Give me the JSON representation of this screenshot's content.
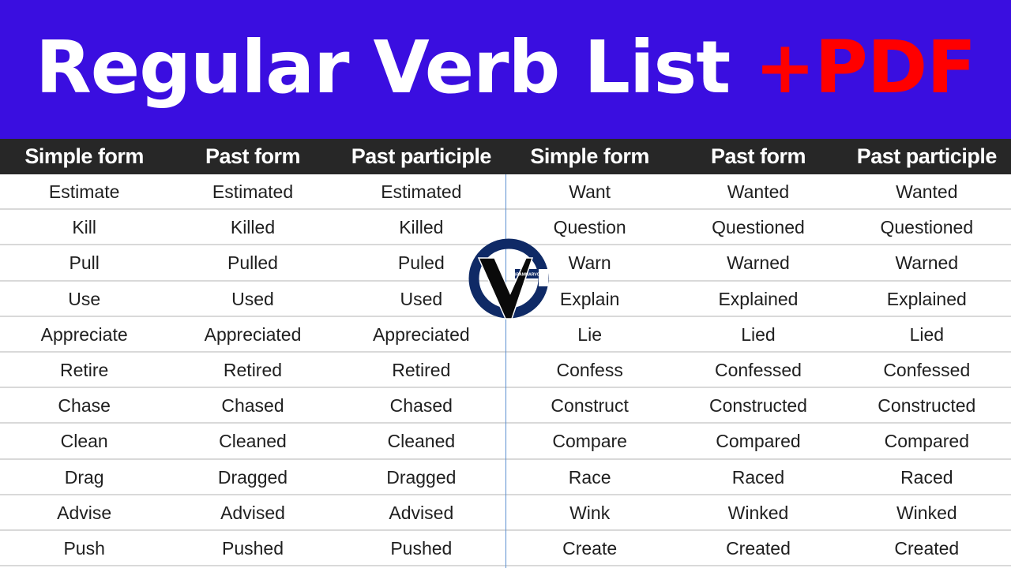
{
  "banner": {
    "title": "Regular Verb List ",
    "accent": "+PDF",
    "background_color": "#3a0ee0",
    "accent_color": "#ff0000"
  },
  "table": {
    "headers": [
      "Simple form",
      "Past form",
      "Past participle",
      "Simple form",
      "Past form",
      "Past participle"
    ],
    "rows": [
      [
        "Estimate",
        "Estimated",
        "Estimated",
        "Want",
        "Wanted",
        "Wanted"
      ],
      [
        "Kill",
        "Killed",
        "Killed",
        "Question",
        "Questioned",
        "Questioned"
      ],
      [
        "Pull",
        "Pulled",
        "Puled",
        "Warn",
        "Warned",
        "Warned"
      ],
      [
        "Use",
        "Used",
        "Used",
        "Explain",
        "Explained",
        "Explained"
      ],
      [
        "Appreciate",
        "Appreciated",
        "Appreciated",
        "Lie",
        "Lied",
        "Lied"
      ],
      [
        "Retire",
        "Retired",
        "Retired",
        "Confess",
        "Confessed",
        "Confessed"
      ],
      [
        "Chase",
        "Chased",
        "Chased",
        "Construct",
        "Constructed",
        "Constructed"
      ],
      [
        "Clean",
        "Cleaned",
        "Cleaned",
        "Compare",
        "Compared",
        "Compared"
      ],
      [
        "Drag",
        "Dragged",
        "Dragged",
        "Race",
        "Raced",
        "Raced"
      ],
      [
        "Advise",
        "Advised",
        "Advised",
        "Wink",
        "Winked",
        "Winked"
      ],
      [
        "Push",
        "Pushed",
        "Pushed",
        "Create",
        "Created",
        "Created"
      ]
    ]
  },
  "logo": {
    "icon": "grammarvocab-logo-icon",
    "text": "GRAMMARVOCAB"
  }
}
